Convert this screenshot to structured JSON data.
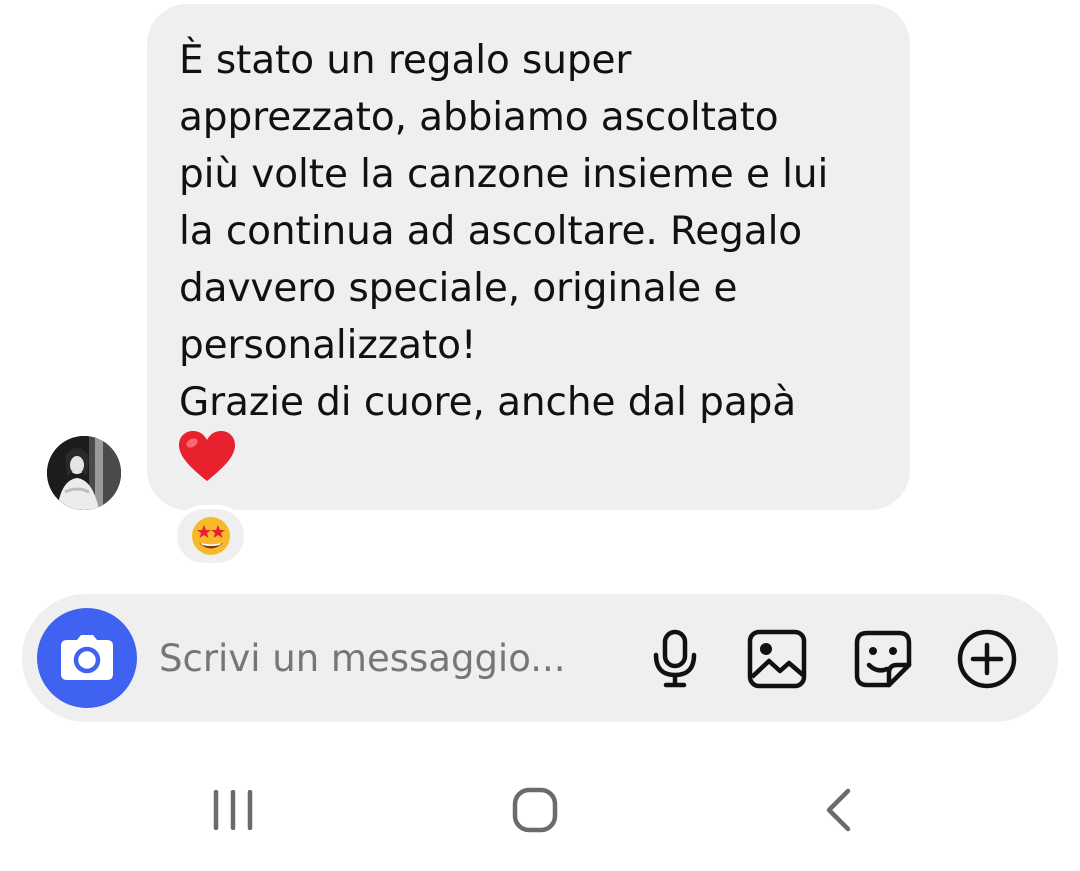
{
  "message": {
    "lines": [
      "È stato un regalo super",
      "apprezzato, abbiamo ascoltato",
      "più volte la canzone insieme e lui",
      "la continua ad ascoltare. Regalo",
      "davvero speciale, originale e",
      "personalizzato!",
      "Grazie di cuore, anche dal papà"
    ],
    "trailing_emoji": "red-heart",
    "reaction_emoji": "star-struck"
  },
  "composer": {
    "placeholder": "Scrivi un messaggio...",
    "value": "",
    "camera_icon": "camera-icon",
    "icons": [
      "microphone-icon",
      "image-icon",
      "sticker-icon",
      "plus-circle-icon"
    ]
  },
  "navbar": {
    "icons": [
      "recent-apps-icon",
      "home-icon",
      "back-icon"
    ]
  },
  "colors": {
    "bubble": "#efefef",
    "camera_button": "#3f63f0",
    "text": "#111111",
    "placeholder": "#767676",
    "nav_icons": "#6b6b6b"
  }
}
